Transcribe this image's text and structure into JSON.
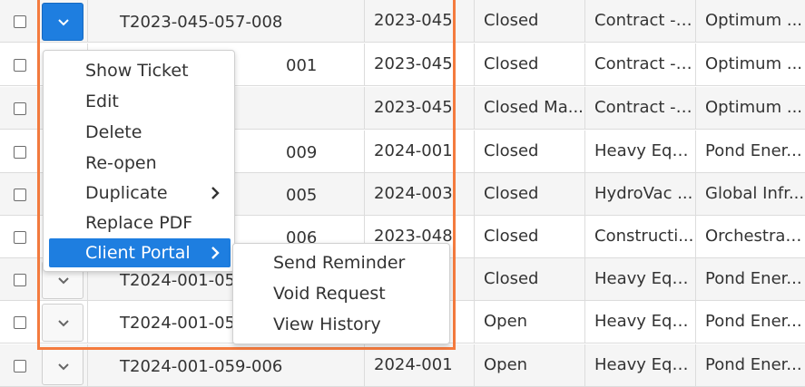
{
  "rows": [
    {
      "ticket": "T2023-045-057-008",
      "year": "2023-045",
      "status": "Closed",
      "type": "Contract - ...",
      "client": "Optimum ..."
    },
    {
      "ticket": "001",
      "year": "2023-045",
      "status": "Closed",
      "type": "Contract - ...",
      "client": "Optimum ..."
    },
    {
      "ticket": "",
      "year": "2023-045",
      "status": "Closed Ma...",
      "type": "Contract - ...",
      "client": "Optimum ..."
    },
    {
      "ticket": "009",
      "year": "2024-001",
      "status": "Closed",
      "type": "Heavy Equ...",
      "client": "Pond Ener..."
    },
    {
      "ticket": "005",
      "year": "2024-003",
      "status": "Closed",
      "type": "HydroVac ...",
      "client": "Global Infr..."
    },
    {
      "ticket": "006",
      "year": "2023-048",
      "status": "Closed",
      "type": "Constructi...",
      "client": "Orchestra ..."
    },
    {
      "ticket": "T2024-001-059-",
      "year": "",
      "status": "Closed",
      "type": "Heavy Equ...",
      "client": "Pond Ener..."
    },
    {
      "ticket": "T2024-001-059-",
      "year": "",
      "status": "Open",
      "type": "Heavy Equ...",
      "client": "Pond Ener..."
    },
    {
      "ticket": "T2024-001-059-006",
      "year": "2024-001",
      "status": "Open",
      "type": "Heavy Equ...",
      "client": "Pond Ener..."
    }
  ],
  "context_menu": {
    "items": [
      "Show Ticket",
      "Edit",
      "Delete",
      "Re-open",
      "Duplicate",
      "Replace PDF",
      "Client Portal"
    ],
    "selected": "Client Portal"
  },
  "submenu": {
    "items": [
      "Send Reminder",
      "Void Request",
      "View History"
    ]
  },
  "colors": {
    "accent": "#1e7ee0",
    "highlight_border": "#f47b3e"
  },
  "icons": {
    "row_action": "chevron-down-icon",
    "submenu_arrow": "chevron-right-icon"
  }
}
